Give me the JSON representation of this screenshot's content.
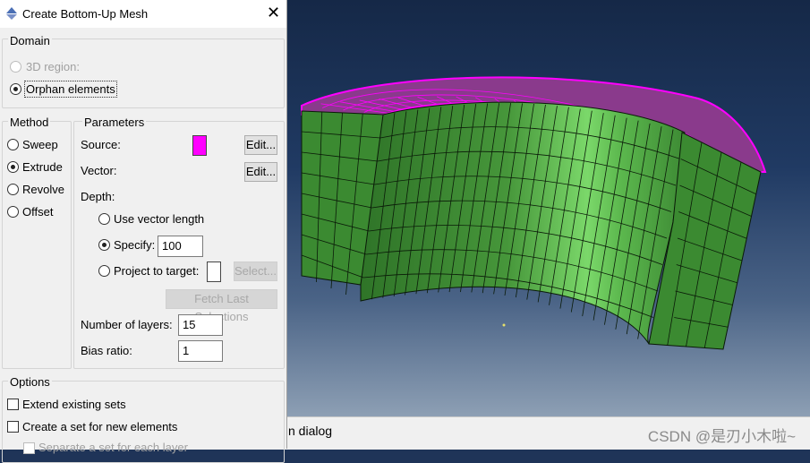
{
  "dialog": {
    "title": "Create Bottom-Up Mesh",
    "close_glyph": "✕",
    "domain": {
      "label": "Domain",
      "options": [
        {
          "label": "3D region:",
          "checked": false,
          "enabled": false
        },
        {
          "label": "Orphan elements",
          "checked": true,
          "enabled": true
        }
      ]
    },
    "method": {
      "label": "Method",
      "options": [
        {
          "label": "Sweep",
          "checked": false
        },
        {
          "label": "Extrude",
          "checked": true
        },
        {
          "label": "Revolve",
          "checked": false
        },
        {
          "label": "Offset",
          "checked": false
        }
      ]
    },
    "parameters": {
      "label": "Parameters",
      "source_label": "Source:",
      "source_color": "#ff00ff",
      "source_button": "Edit...",
      "vector_label": "Vector:",
      "vector_button": "Edit...",
      "depth_label": "Depth:",
      "use_vector_length": "Use vector length",
      "specify_label": "Specify:",
      "specify_value": "100",
      "project_label": "Project to target:",
      "select_button": "Select...",
      "fetch_button": "Fetch Last Selections",
      "layers_label": "Number of layers:",
      "layers_value": "15",
      "bias_label": "Bias ratio:",
      "bias_value": "1"
    },
    "options": {
      "label": "Options",
      "extend_sets": "Extend existing sets",
      "create_set": "Create a set for new elements",
      "separate_set": "Separate a set for each layer"
    }
  },
  "viewport": {
    "mesh_color": "#3d8a34",
    "highlight_color": "#ff00ff",
    "edge_color": "#0a1a08"
  },
  "status_bar": {
    "prompt_fragment": "n dialog",
    "watermark": "CSDN @是刃小木啦~"
  }
}
